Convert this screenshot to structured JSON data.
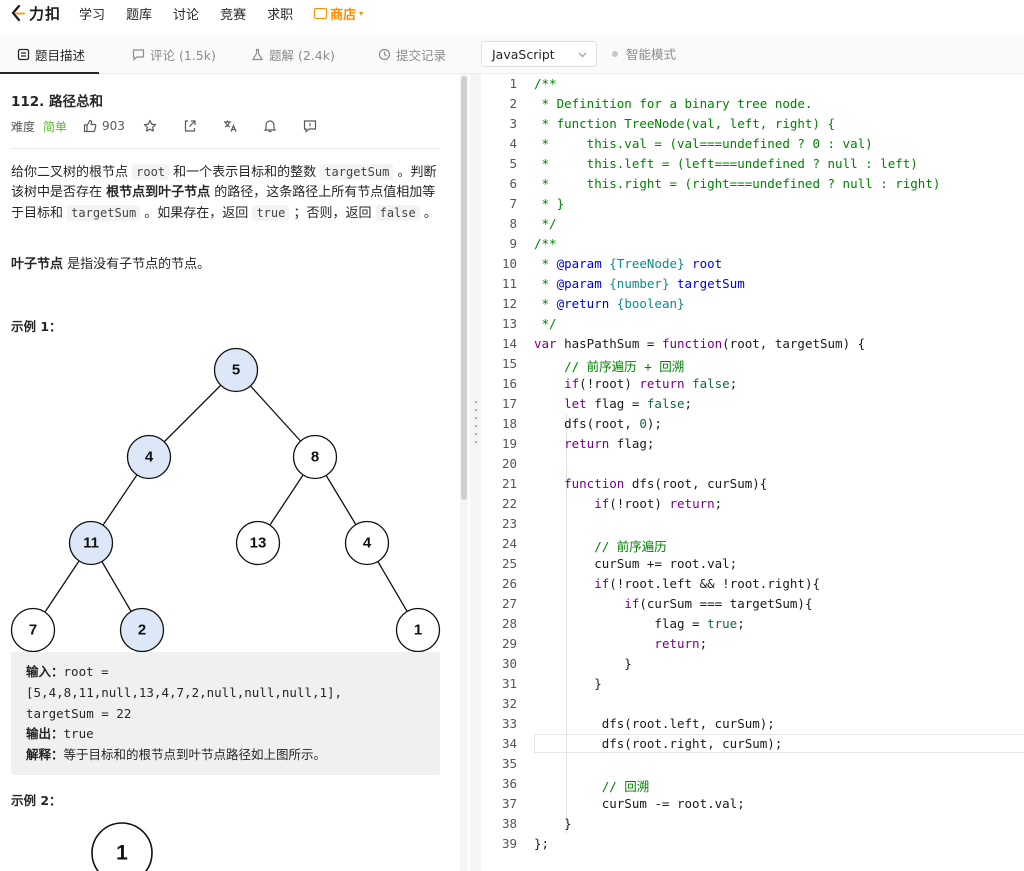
{
  "nav": {
    "logo_text": "力扣",
    "items": [
      "学习",
      "题库",
      "讨论",
      "竞赛",
      "求职"
    ],
    "store": "商店"
  },
  "tabs": {
    "description": "题目描述",
    "comments": "评论 (1.5k)",
    "solutions": "题解 (2.4k)",
    "submissions": "提交记录"
  },
  "editor_bar": {
    "language": "JavaScript",
    "smart_mode": "智能模式"
  },
  "problem": {
    "title": "112. 路径总和",
    "difficulty_label": "难度",
    "difficulty": "简单",
    "likes": "903",
    "desc": {
      "p1": "给你二叉树的根节点 ",
      "c1": "root",
      "p2": " 和一个表示目标和的整数 ",
      "c2": "targetSum",
      "p3": " 。判断该树中是否存在 ",
      "b1": "根节点到叶子节点",
      "p4": " 的路径，这条路径上所有节点值相加等于目标和 ",
      "c3": "targetSum",
      "p5": " 。如果存在，返回 ",
      "c4": "true",
      "p6": " ；否则，返回 ",
      "c5": "false",
      "p7": " 。"
    },
    "leaf": {
      "bold": "叶子节点",
      "rest": " 是指没有子节点的节点。"
    },
    "example1_title": "示例 1：",
    "example2_title": "示例 2：",
    "example1": {
      "input_label": "输入：",
      "input_1": "root =",
      "input_2": "[5,4,8,11,null,13,4,7,2,null,null,null,1],",
      "input_3": "targetSum = 22",
      "output_label": "输出：",
      "output": "true",
      "explain_label": "解释：",
      "explain": "等于目标和的根节点到叶节点路径如上图所示。"
    },
    "tree1_nodes": [
      "5",
      "4",
      "8",
      "11",
      "13",
      "4",
      "7",
      "2",
      "1"
    ],
    "tree2_nodes": [
      "1"
    ]
  },
  "line_numbers": [
    "1",
    "2",
    "3",
    "4",
    "5",
    "6",
    "7",
    "8",
    "9",
    "10",
    "11",
    "12",
    "13",
    "14",
    "15",
    "16",
    "17",
    "18",
    "19",
    "20",
    "21",
    "22",
    "23",
    "24",
    "25",
    "26",
    "27",
    "28",
    "29",
    "30",
    "31",
    "32",
    "33",
    "34",
    "35",
    "36",
    "37",
    "38",
    "39"
  ],
  "code": {
    "l1": "/**",
    "l2": " * Definition for a binary tree node.",
    "l3": " * function TreeNode(val, left, right) {",
    "l4": " *     this.val = (val===undefined ? 0 : val)",
    "l5": " *     this.left = (left===undefined ? null : left)",
    "l6": " *     this.right = (right===undefined ? null : right)",
    "l7": " * }",
    "l8": " */",
    "l9": "/**",
    "l10a": " * ",
    "l10b": "@param",
    "l10c": " ",
    "l10d": "{TreeNode}",
    "l10e": " root",
    "l11a": " * ",
    "l11b": "@param",
    "l11c": " ",
    "l11d": "{number}",
    "l11e": " targetSum",
    "l12a": " * ",
    "l12b": "@return",
    "l12c": " ",
    "l12d": "{boolean}",
    "l13": " */",
    "l14a": "var",
    "l14b": " hasPathSum = ",
    "l14c": "function",
    "l14d": "(root, targetSum) {",
    "l15": "    // 前序遍历 + 回溯",
    "l16a": "    ",
    "l16b": "if",
    "l16c": "(!root) ",
    "l16d": "return",
    "l16e": " ",
    "l16f": "false",
    "l16g": ";",
    "l17a": "    ",
    "l17b": "let",
    "l17c": " flag = ",
    "l17d": "false",
    "l17e": ";",
    "l18a": "    dfs(root, ",
    "l18b": "0",
    "l18c": ");",
    "l19a": "    ",
    "l19b": "return",
    "l19c": " flag;",
    "l21a": "    ",
    "l21b": "function",
    "l21c": " dfs(root, curSum){",
    "l22a": "        ",
    "l22b": "if",
    "l22c": "(!root) ",
    "l22d": "return",
    "l22e": ";",
    "l24": "        // 前序遍历",
    "l25": "        curSum += root.val;",
    "l26a": "        ",
    "l26b": "if",
    "l26c": "(!root.left && !root.right){",
    "l27a": "            ",
    "l27b": "if",
    "l27c": "(curSum === targetSum){",
    "l28a": "                flag = ",
    "l28b": "true",
    "l28c": ";",
    "l29a": "                ",
    "l29b": "return",
    "l29c": ";",
    "l30": "            }",
    "l31": "        }",
    "l33": "         dfs(root.left, curSum);",
    "l34": "         dfs(root.right, curSum);",
    "l36": "         // 回溯",
    "l37": "         curSum -= root.val;",
    "l38": "    }",
    "l39": "};"
  }
}
